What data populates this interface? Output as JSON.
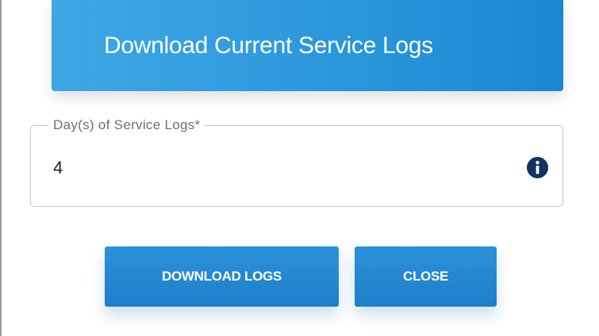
{
  "header": {
    "title": "Download Current Service Logs"
  },
  "days_field": {
    "label": "Day(s) of Service Logs*",
    "value": "4",
    "info_icon": "info-icon"
  },
  "actions": {
    "download_label": "DOWNLOAD LOGS",
    "close_label": "CLOSE"
  },
  "colors": {
    "header_gradient_start": "#3ea8e6",
    "header_gradient_end": "#1a87d2",
    "button": "#1d7fca",
    "info_icon": "#12335f"
  }
}
